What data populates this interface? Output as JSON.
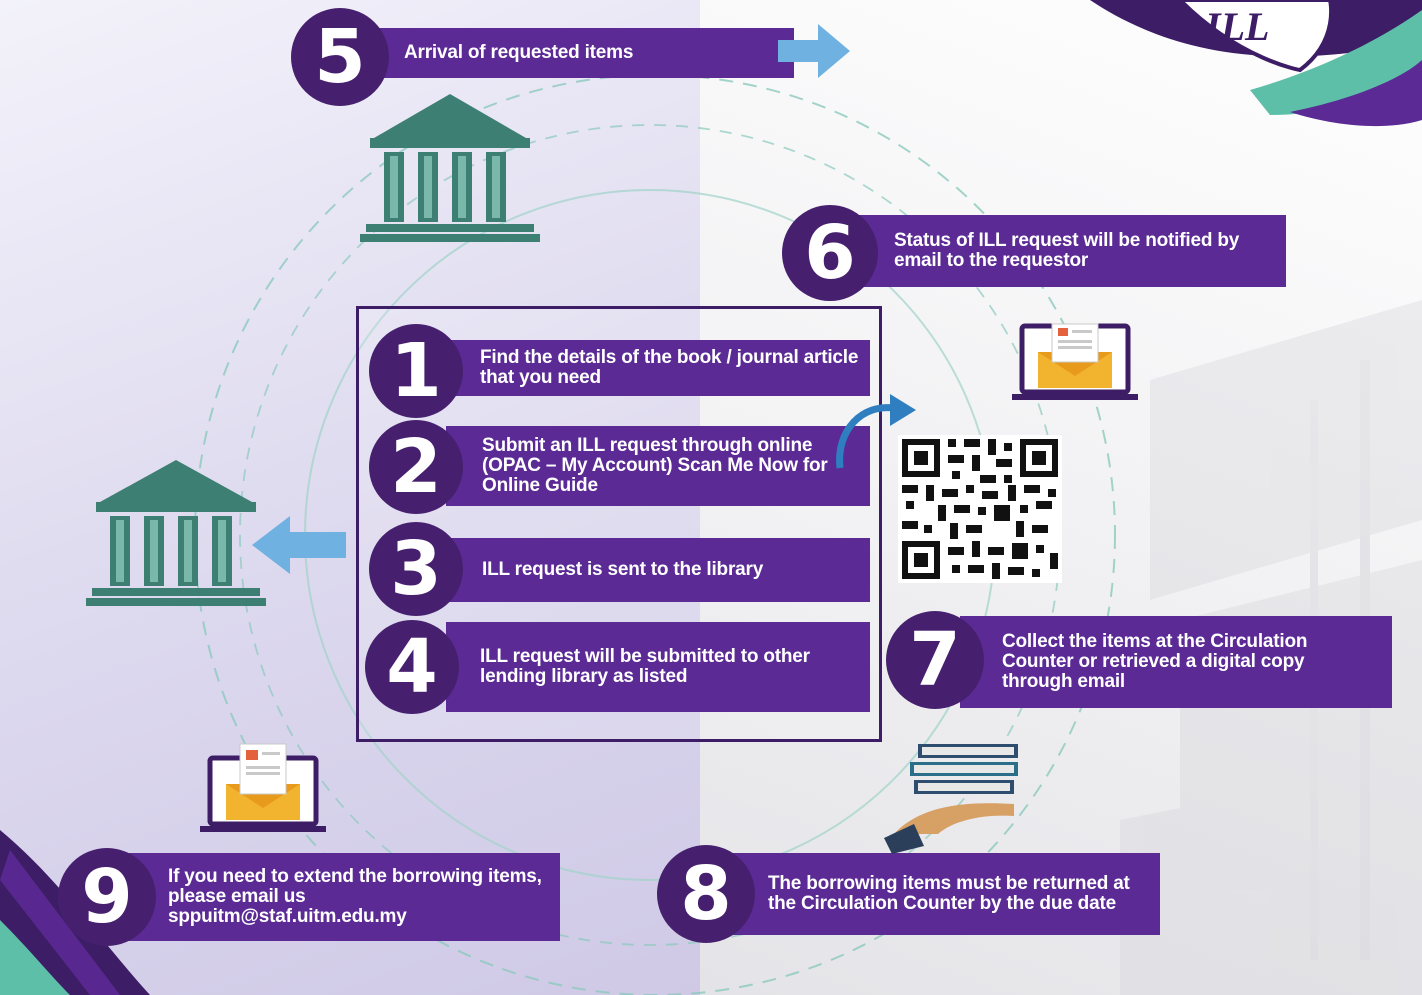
{
  "steps": [
    {
      "num": "1",
      "text": "Find the details of the book / journal article that you need"
    },
    {
      "num": "2",
      "text": "Submit an ILL request through online (OPAC – My Account) Scan Me Now for Online Guide"
    },
    {
      "num": "3",
      "text": "ILL request is sent to the library"
    },
    {
      "num": "4",
      "text": "ILL request will be submitted to other lending library as listed"
    },
    {
      "num": "5",
      "text": "Arrival of requested items"
    },
    {
      "num": "6",
      "text": "Status of ILL request will be notified by email to the requestor"
    },
    {
      "num": "7",
      "text": "Collect the items at the Circulation Counter or retrieved a digital copy through email"
    },
    {
      "num": "8",
      "text": "The borrowing items must be returned at the Circulation Counter by the due date"
    },
    {
      "num": "9",
      "text": "If you need to extend the borrowing items, please email us sppuitm@staf.uitm.edu.my"
    }
  ],
  "colors": {
    "purple": "#5b2a95",
    "dark_purple": "#46206f",
    "teal": "#3d7f73",
    "arrow_blue": "#6fb1e0"
  },
  "icons": [
    "library-building-icon",
    "email-laptop-icon",
    "books-hand-icon",
    "qr-code-icon",
    "arrow-right-icon",
    "arrow-left-icon",
    "curved-arrow-icon"
  ]
}
